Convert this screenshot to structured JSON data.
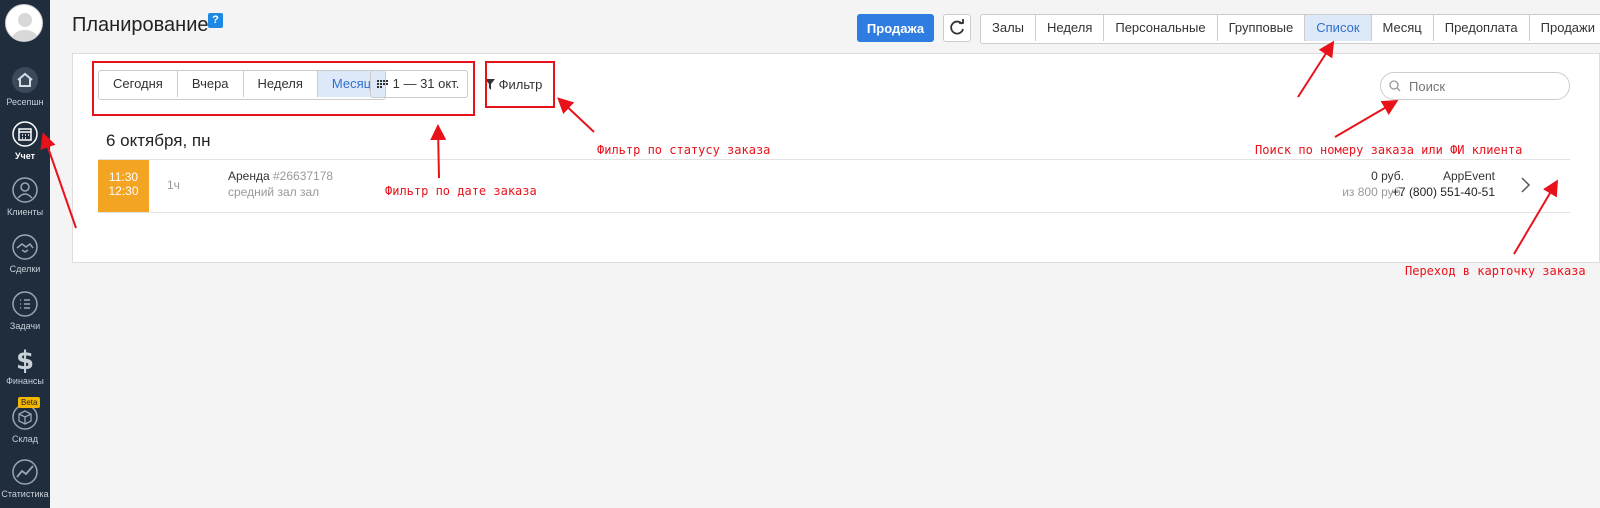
{
  "sidebar": {
    "items": [
      {
        "label": "Ресепшн",
        "icon": "home-icon"
      },
      {
        "label": "Учет",
        "icon": "calendar-icon"
      },
      {
        "label": "Клиенты",
        "icon": "clients-icon"
      },
      {
        "label": "Сделки",
        "icon": "handshake-icon"
      },
      {
        "label": "Задачи",
        "icon": "tasks-icon"
      },
      {
        "label": "Финансы",
        "icon": "dollar-icon"
      },
      {
        "label": "Склад",
        "icon": "box-icon",
        "badge": "Beta"
      },
      {
        "label": "Статистика",
        "icon": "chart-icon"
      }
    ]
  },
  "header": {
    "title": "Планирование",
    "help": "?",
    "sale_button": "Продажа",
    "view_tabs": [
      "Залы",
      "Неделя",
      "Персональные",
      "Групповые",
      "Список",
      "Месяц",
      "Предоплата",
      "Продажи"
    ],
    "active_view": "Список"
  },
  "toolbar": {
    "date_tabs": [
      "Сегодня",
      "Вчера",
      "Неделя",
      "Месяц"
    ],
    "active_date_tab": "Месяц",
    "range": "1 — 31 окт.",
    "filter_label": "Фильтр",
    "search_placeholder": "Поиск"
  },
  "day": {
    "heading": "6 октября, пн",
    "orders": [
      {
        "start": "11:30",
        "end": "12:30",
        "duration": "1ч",
        "title": "Аренда",
        "number": "#26637178",
        "hall": "средний зал зал",
        "price": "0 руб.",
        "price_of": "из 800 руб.",
        "client": "AppEvent",
        "phone": "+7 (800) 551-40-51"
      }
    ]
  },
  "annotations": {
    "date_filter": "Фильтр по дате заказа",
    "status_filter": "Фильтр по статусу заказа",
    "search": "Поиск по номеру заказа или ФИ клиента",
    "order_card": "Переход в карточку заказа",
    "color": "#e8121b"
  }
}
